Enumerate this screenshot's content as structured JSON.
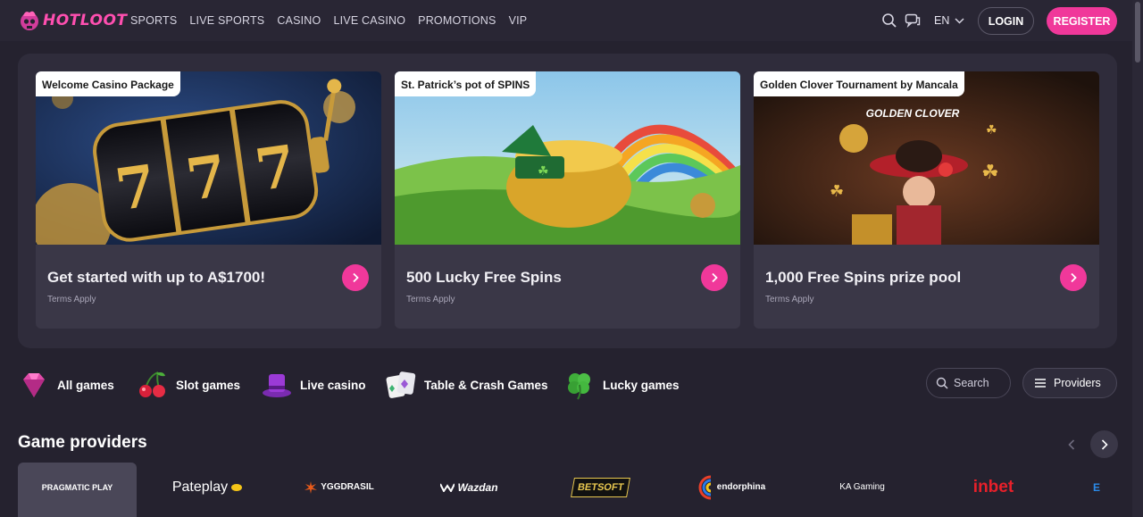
{
  "header": {
    "logo_text": "HOTLOOT",
    "nav": [
      "SPORTS",
      "LIVE SPORTS",
      "CASINO",
      "LIVE CASINO",
      "PROMOTIONS",
      "VIP"
    ],
    "language": "EN",
    "login_label": "LOGIN",
    "register_label": "REGISTER"
  },
  "promos": [
    {
      "tag": "Welcome Casino Package",
      "title": "Get started with up to A$1700!",
      "terms": "Terms Apply"
    },
    {
      "tag": "St. Patrick’s pot of SPINS",
      "title": "500 Lucky Free Spins",
      "terms": "Terms Apply"
    },
    {
      "tag": "Golden Clover Tournament by Mancala",
      "title": "1,000 Free Spins prize pool",
      "terms": "Terms Apply",
      "image_text": "GOLDEN CLOVER"
    }
  ],
  "categories": [
    {
      "label": "All games",
      "icon": "gem-icon"
    },
    {
      "label": "Slot games",
      "icon": "cherries-icon"
    },
    {
      "label": "Live casino",
      "icon": "top-hat-icon"
    },
    {
      "label": "Table & Crash Games",
      "icon": "cards-icon"
    },
    {
      "label": "Lucky games",
      "icon": "clover-icon"
    }
  ],
  "search": {
    "placeholder": "Search"
  },
  "providers_button": "Providers",
  "game_providers": {
    "title": "Game providers",
    "items": [
      {
        "name": "PRAGMATIC PLAY",
        "count": ""
      },
      {
        "name": "Pateplay",
        "count": ""
      },
      {
        "name": "YGGDRASIL",
        "count": ""
      },
      {
        "name": "Wazdan",
        "count": ""
      },
      {
        "name": "BETSOFT",
        "count": ""
      },
      {
        "name": "endorphina",
        "count": ""
      },
      {
        "name": "KA Gaming",
        "count": ""
      },
      {
        "name": "inbet",
        "count": ""
      },
      {
        "name": "E",
        "count": ""
      }
    ]
  },
  "colors": {
    "accent": "#f0389a",
    "background": "#25222f",
    "panel": "#2f2c3b",
    "card": "#3a3747"
  }
}
